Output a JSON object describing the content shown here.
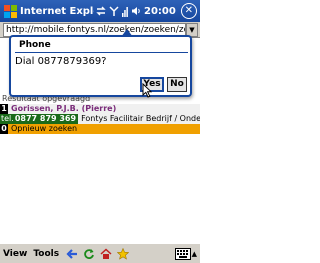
{
  "titlebar": {
    "app_title": "Internet Explorer",
    "clock": "20:00",
    "close_glyph": "✕"
  },
  "addressbar": {
    "url": "http://mobile.fontys.nl/zoeken/zoeken/zoeken/zoeken",
    "dropdown_glyph": "▼"
  },
  "content": {
    "caption": "Resultaat opgevraagd",
    "person_index": "1",
    "person_name": "Gorissen, P.J.B. (Pierre)",
    "phone_label": "tel.",
    "phone_number": "0877 879 369",
    "organisation": "Fontys Facilitair Bedrijf / Onderwijs",
    "research_index": "0",
    "research_label": "Opnieuw zoeken"
  },
  "dialog": {
    "title": "Phone",
    "message": "Dial 0877879369?",
    "yes_label": "Yes",
    "no_label": "No"
  },
  "menubar": {
    "view_label": "View",
    "tools_label": "Tools",
    "keyboard_arrow": "▲"
  },
  "colors": {
    "title_bar": "#16479e",
    "person_name": "#7a2c7a",
    "phone_bg": "#1a6a1a",
    "research_bg": "#f0a000"
  }
}
